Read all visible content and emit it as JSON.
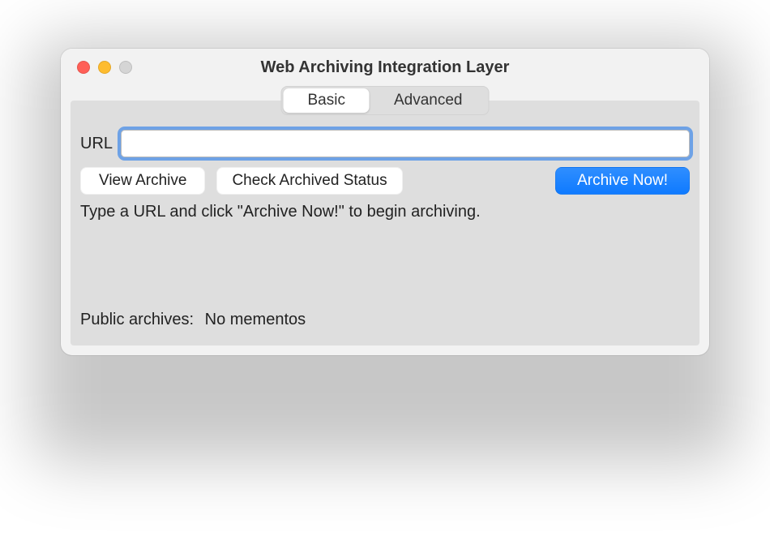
{
  "window": {
    "title": "Web Archiving Integration Layer"
  },
  "tabs": {
    "basic": "Basic",
    "advanced": "Advanced"
  },
  "url": {
    "label": "URL",
    "value": ""
  },
  "buttons": {
    "view_archive": "View Archive",
    "check_status": "Check Archived Status",
    "archive_now": "Archive Now!"
  },
  "hint": "Type a URL and click \"Archive Now!\" to begin archiving.",
  "public_archives": {
    "label": "Public archives:",
    "value": "No mementos"
  }
}
